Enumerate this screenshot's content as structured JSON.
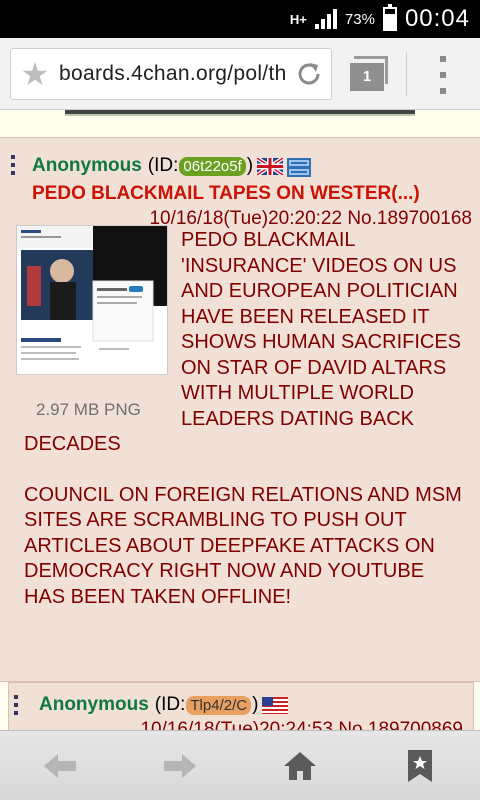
{
  "status_bar": {
    "network": "H+",
    "battery_pct": "73%",
    "battery_level": 0.73,
    "time": "00:04"
  },
  "browser": {
    "url": "boards.4chan.org/pol/th",
    "tab_count": "1",
    "icons": [
      "star-icon",
      "reload-icon",
      "tabs-icon",
      "overflow-menu-icon"
    ]
  },
  "posts": [
    {
      "name": "Anonymous",
      "id_prefix": "(ID: ",
      "poster_id": "06t22o5f",
      "id_suffix": ")",
      "id_color": "#6aa120",
      "subject": "PEDO BLACKMAIL TAPES ON WESTER(...)",
      "datetime": "10/16/18(Tue)20:20:22 No.189700168",
      "file_size": "2.97 MB PNG",
      "body_para_1": "PEDO BLACKMAIL 'INSURANCE' VIDEOS ON US AND EUROPEAN POLITICIAN HAVE BEEN RELEASED IT SHOWS HUMAN SACRIFICES ON STAR OF DAVID ALTARS WITH MULTIPLE WORLD LEADERS DATING BACK DECADES",
      "body_para_2": "COUNCIL ON FOREIGN RELATIONS AND MSM SITES ARE SCRAMBLING TO PUSH OUT ARTICLES ABOUT DEEPFAKE ATTACKS ON DEMOCRACY RIGHT NOW AND YOUTUBE HAS BEEN TAKEN OFFLINE!",
      "flags": [
        "uk-flag-icon",
        "blue-flag-icon"
      ]
    },
    {
      "name": "Anonymous",
      "id_prefix": "(ID: ",
      "poster_id": "Tlp4/2/C",
      "id_suffix": ")",
      "id_color": "#e8a060",
      "datetime": "10/16/18(Tue)20:24:53 No.189700869",
      "flags": [
        "us-flag-icon"
      ]
    }
  ],
  "colors": {
    "post_bg": "#f0e0d6",
    "name": "#117743",
    "subject": "#cc1105",
    "text": "#800000",
    "page_bg": "#ffffee"
  },
  "bottom_nav": {
    "icons": [
      "back-arrow-icon",
      "forward-arrow-icon",
      "home-icon",
      "bookmark-icon"
    ]
  }
}
